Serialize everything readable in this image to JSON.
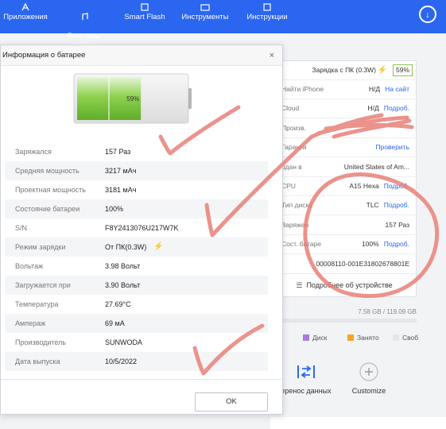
{
  "topbar": {
    "nav": [
      {
        "label": "Приложения",
        "icon": "apps-icon"
      },
      {
        "label": "Рингтоны\nи Обои",
        "icon": "ringtone-icon"
      },
      {
        "label": "Smart Flash",
        "icon": "flash-icon"
      },
      {
        "label": "Инструменты",
        "icon": "tools-icon"
      },
      {
        "label": "Инструкции",
        "icon": "instructions-icon"
      }
    ],
    "download_icon": "download-icon"
  },
  "dialog": {
    "title": "Информация о батарее",
    "battery_level": 0.59,
    "battery_percent": "59%",
    "rows": [
      {
        "label": "Заряжался",
        "value": "157 Раз"
      },
      {
        "label": "Средняя мощность",
        "value": "3217 мАч"
      },
      {
        "label": "Проектная мощность",
        "value": "3181 мАч"
      },
      {
        "label": "Состояние батареи",
        "value": "100%"
      },
      {
        "label": "S/N",
        "value": "F8Y2413076U217W7K"
      },
      {
        "label": "Режим зарядки",
        "value": "От ПК(0.3W)"
      },
      {
        "label": "Вольтаж",
        "value": "3.98 Вольт"
      },
      {
        "label": "Загружается при",
        "value": "3.90 Вольт"
      },
      {
        "label": "Температура",
        "value": "27.69°C"
      },
      {
        "label": "Ампераж",
        "value": "69 мА"
      },
      {
        "label": "Производитель",
        "value": "SUNWODA"
      },
      {
        "label": "Дата выпуска",
        "value": "10/5/2022"
      }
    ],
    "ok_label": "OK",
    "close_glyph": "×"
  },
  "device_info": {
    "charging_label": "Зарядка с ПК (0.3W)",
    "charge_percent": "59%",
    "rows": [
      {
        "label": "Найти iPhone",
        "value": "Н/Д",
        "link": "На сайт"
      },
      {
        "label": "Cloud",
        "value": "Н/Д",
        "link": "Подроб."
      },
      {
        "label": "Произв.",
        "value": "",
        "link": ""
      },
      {
        "label": "Гаранти",
        "value": "",
        "link": "Проверить"
      },
      {
        "label": "одан в",
        "value": "United States of Am...",
        "link": ""
      },
      {
        "label": "CPU",
        "value": "A15 Hexa",
        "link": "Подроб."
      },
      {
        "label": "Тип диска",
        "value": "TLC",
        "link": "Подроб."
      },
      {
        "label": "Заряжен",
        "value": "157 Раз",
        "link": ""
      },
      {
        "label": "Сост. батаре",
        "value": "100%",
        "link": "Подроб."
      },
      {
        "label": "",
        "value": "00008110-001E31802678801E",
        "link": ""
      }
    ],
    "details_button": "Подробнее об устройстве",
    "storage_text": "7.58 GB / 119.09 GB",
    "storage_used_fraction": 0.064,
    "legend": [
      {
        "label": "Диск",
        "color": "#a77ae0"
      },
      {
        "label": "Занято",
        "color": "#f5a623"
      },
      {
        "label": "Своб",
        "color": "#e4e6ea"
      }
    ],
    "tools": [
      {
        "label": "еренос данных",
        "icon": "transfer-icon"
      },
      {
        "label": "Customize",
        "icon": "plus-icon"
      }
    ]
  },
  "colors": {
    "brand": "#2b66f0",
    "battery_green": "#7cc243",
    "annotation_red": "#e98078"
  }
}
